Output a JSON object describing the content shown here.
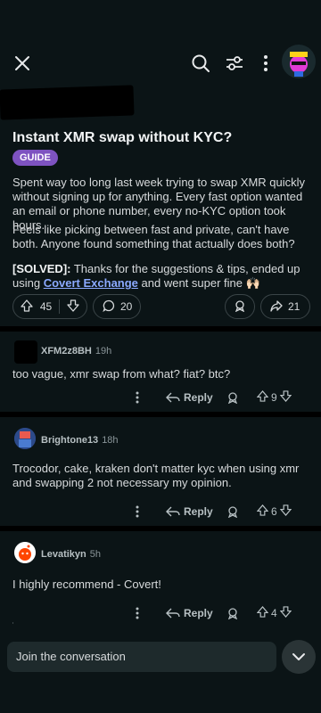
{
  "header": {
    "icons": [
      "close-icon",
      "search-icon",
      "filter-icon",
      "more-icon",
      "avatar"
    ]
  },
  "post": {
    "title": "Instant XMR swap without KYC?",
    "flair": "GUIDE",
    "flair_color": "#7e53c1",
    "paragraph_1": "Spent way too long last week trying to swap XMR quickly without signing up for anything. Every fast option wanted an email or phone number, every no-KYC option took hours.",
    "paragraph_2": "Feels like picking between fast and private, can't have both. Anyone found something that actually does both?",
    "solved_label": "[SOLVED]:",
    "paragraph_3_a": " Thanks for the suggestions & tips, ended up using ",
    "link_text": "Covert Exchange",
    "paragraph_3_b": " and went super fine 🙌🏻",
    "upvotes": "45",
    "comments": "20",
    "shares": "21"
  },
  "comments": [
    {
      "user": "XFM2z8BH",
      "time": "19h",
      "body": "too vague, xmr swap from what? fiat? btc?",
      "reply_label": "Reply",
      "votes": "9"
    },
    {
      "user": "Brightone13",
      "time": "18h",
      "body": "Trocodor, cake, kraken don't matter kyc when using xmr and swapping 2 not necessary my opinion.",
      "reply_label": "Reply",
      "votes": "6"
    },
    {
      "user": "Levatikyn",
      "time": "5h",
      "body": "I highly recommend - Covert!",
      "reply_label": "Reply",
      "votes": "4"
    }
  ],
  "footer": {
    "join_placeholder": "Join the conversation"
  },
  "colors": {
    "background": "#0b1416",
    "link": "#8ba9ff",
    "flair": "#7e53c1"
  }
}
